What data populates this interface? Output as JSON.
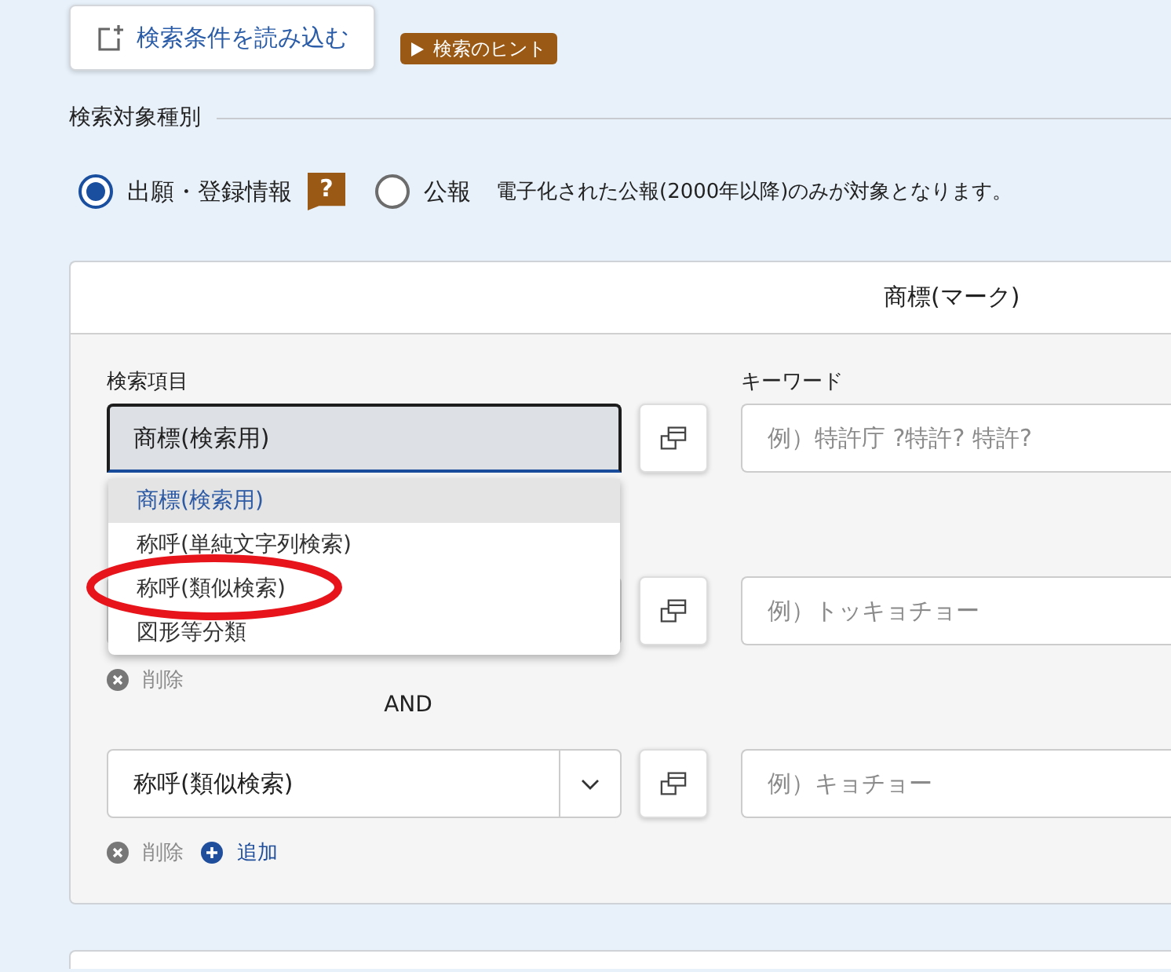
{
  "load_button": {
    "label": "検索条件を読み込む"
  },
  "hint_link": {
    "label": "検索のヒント"
  },
  "search_target": {
    "title": "検索対象種別",
    "options": [
      {
        "label": "出願・登録情報",
        "selected": true,
        "help": "?"
      },
      {
        "label": "公報",
        "selected": false
      }
    ],
    "note": "電子化された公報(2000年以降)のみが対象となります。"
  },
  "search_card": {
    "title": "商標(マーク)",
    "field_label": "検索項目",
    "keyword_label": "キーワード",
    "rows": [
      {
        "field": {
          "value": "商標(検索用)",
          "expanded": true,
          "options": [
            {
              "label": "商標(検索用)",
              "selected": true,
              "circled": false
            },
            {
              "label": "称呼(単純文字列検索)",
              "selected": false,
              "circled": false
            },
            {
              "label": "称呼(類似検索)",
              "selected": false,
              "circled": true
            },
            {
              "label": "図形等分類",
              "selected": false,
              "circled": false
            }
          ]
        },
        "keyword_placeholder": "例）特許庁 ?特許? 特許?"
      },
      {
        "field": {
          "expanded": false
        },
        "keyword_placeholder": "例）トッキョチョー",
        "actions": [
          {
            "kind": "delete",
            "label": "削除"
          }
        ],
        "operator": "AND"
      },
      {
        "field": {
          "value": "称呼(類似検索)",
          "expanded": false
        },
        "keyword_placeholder": "例）キョチョー",
        "actions": [
          {
            "kind": "delete",
            "label": "削除"
          },
          {
            "kind": "add",
            "label": "追加"
          }
        ]
      }
    ]
  }
}
